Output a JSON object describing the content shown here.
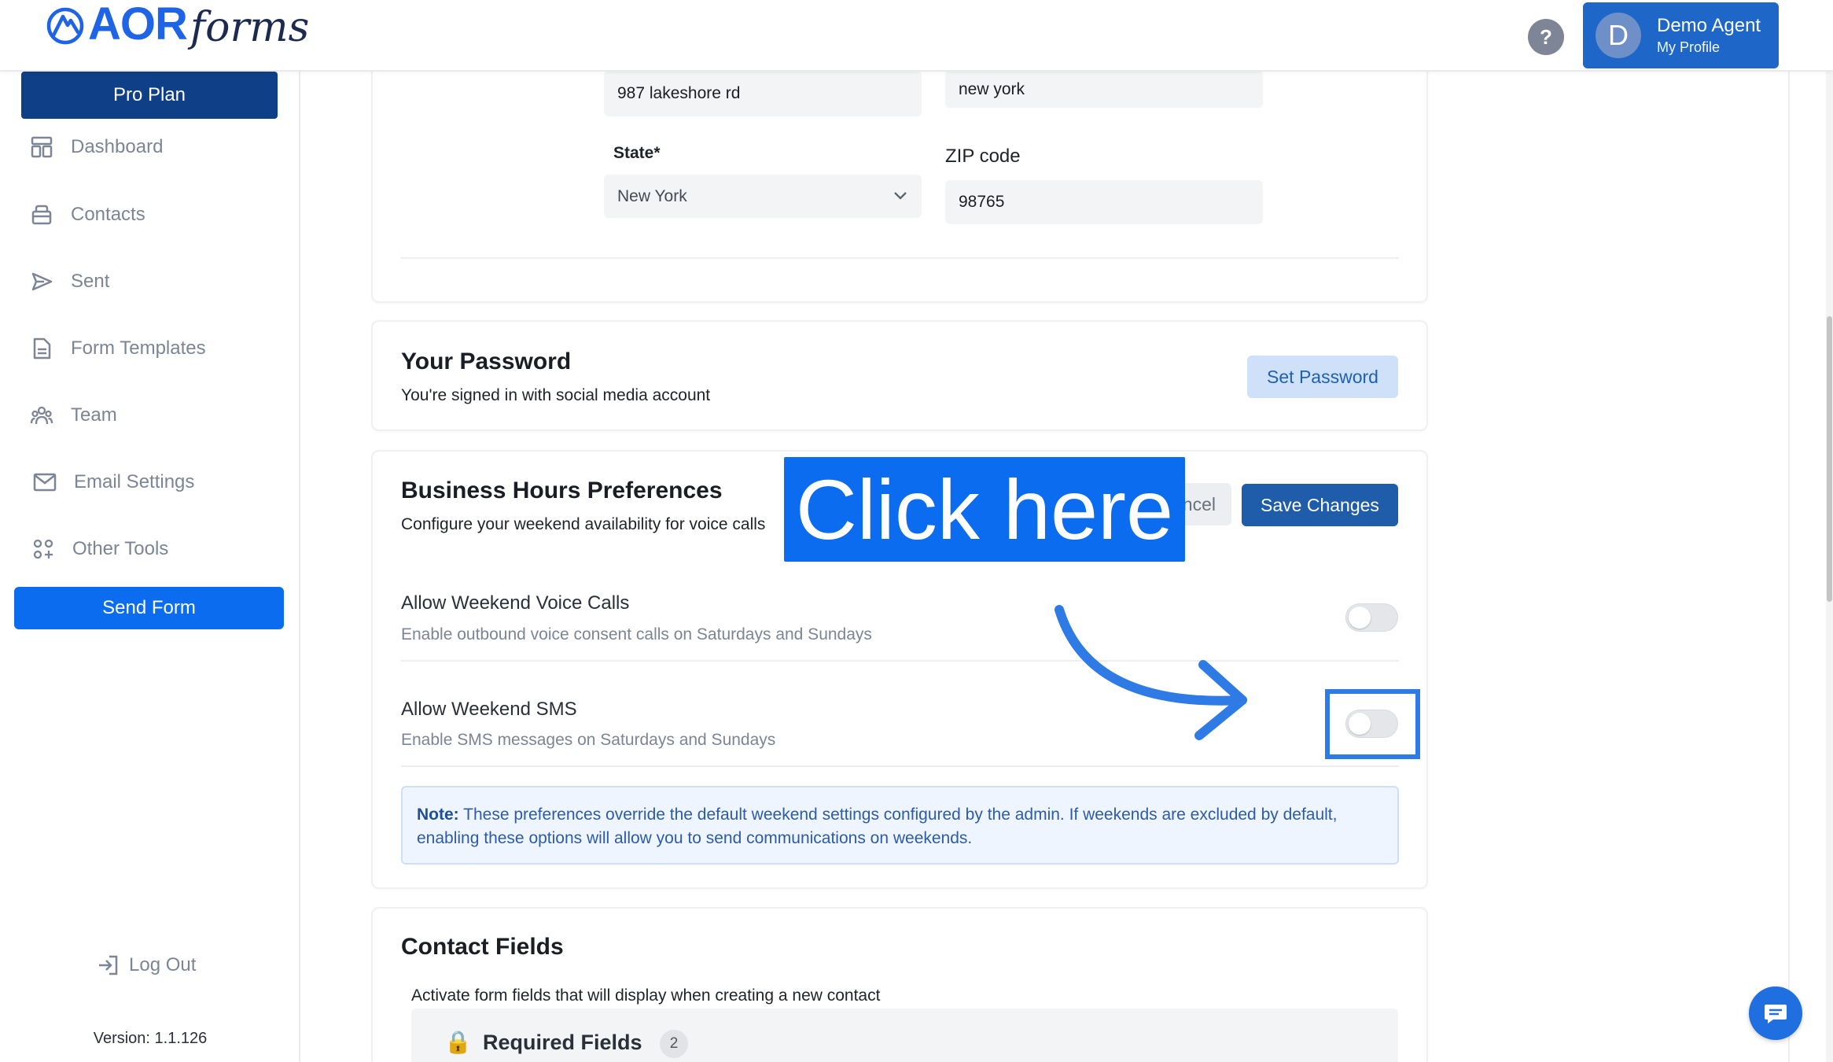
{
  "header": {
    "logo_text_bold": "AOR",
    "logo_text_script": "forms",
    "help_label": "?",
    "profile": {
      "initial": "D",
      "name": "Demo Agent",
      "subtitle": "My Profile"
    }
  },
  "sidebar": {
    "plan_label": "Pro Plan",
    "items": [
      {
        "label": "Dashboard",
        "icon": "dashboard-icon"
      },
      {
        "label": "Contacts",
        "icon": "contacts-icon"
      },
      {
        "label": "Sent",
        "icon": "send-icon"
      },
      {
        "label": "Form Templates",
        "icon": "document-icon"
      },
      {
        "label": "Team",
        "icon": "team-icon"
      },
      {
        "label": "Email Settings",
        "icon": "mail-icon"
      },
      {
        "label": "Other Tools",
        "icon": "grid-icon"
      }
    ],
    "send_form_label": "Send Form",
    "logout_label": "Log Out",
    "version": "Version: 1.1.126"
  },
  "address": {
    "street_value": "987 lakeshore rd",
    "city_value": "new york",
    "state_label": "State*",
    "state_value": "New York",
    "zip_label": "ZIP code",
    "zip_value": "98765"
  },
  "password": {
    "title": "Your Password",
    "subtitle": "You're signed in with social media account",
    "set_password_label": "Set Password"
  },
  "business_hours": {
    "title": "Business Hours Preferences",
    "subtitle": "Configure your weekend availability for voice calls",
    "cancel_label": "ncel",
    "save_label": "Save Changes",
    "rows": [
      {
        "title": "Allow Weekend Voice Calls",
        "subtitle": "Enable outbound voice consent calls on Saturdays and Sundays",
        "enabled": false
      },
      {
        "title": "Allow Weekend SMS",
        "subtitle": "Enable SMS messages on Saturdays and Sundays",
        "enabled": false
      }
    ],
    "note_label": "Note:",
    "note_text": " These preferences override the default weekend settings configured by the admin. If weekends are excluded by default, enabling these options will allow you to send communications on weekends."
  },
  "contact_fields": {
    "title": "Contact Fields",
    "subtitle": "Activate form fields that will display when creating a new contact",
    "required_label": "Required Fields",
    "required_count": "2"
  },
  "overlay": {
    "callout_text": "Click here"
  },
  "colors": {
    "brand_blue": "#0b6cf0",
    "navy": "#0f3f86",
    "callout_blue": "#0b6cf0",
    "highlight_blue": "#2f7be6"
  }
}
